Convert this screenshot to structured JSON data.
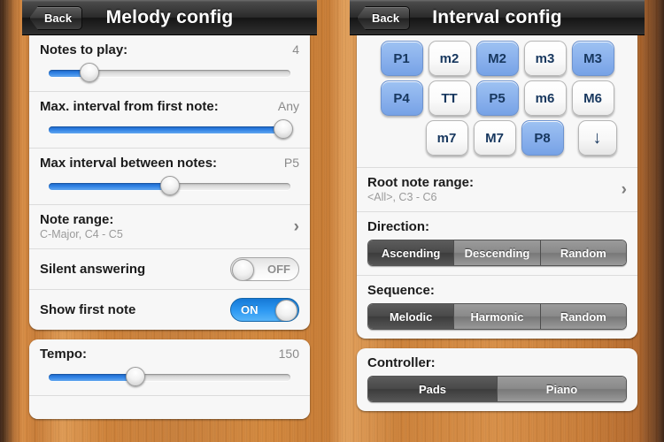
{
  "screens": [
    {
      "nav": {
        "back_label": "Back",
        "title": "Melody config",
        "back_icon": "chevron-left-icon"
      },
      "sliders": [
        {
          "label": "Notes to play:",
          "value": "4",
          "fill_pct": 17
        },
        {
          "label": "Max. interval from first note:",
          "value": "Any",
          "fill_pct": 97
        },
        {
          "label": "Max interval between notes:",
          "value": "P5",
          "fill_pct": 50
        }
      ],
      "note_range": {
        "label": "Note range:",
        "sub": "C-Major, C4 - C5",
        "chevron_icon": "chevron-right-icon"
      },
      "toggles": [
        {
          "label": "Silent answering",
          "state": "OFF",
          "on": false
        },
        {
          "label": "Show first note",
          "state": "ON",
          "on": true
        }
      ],
      "tempo": {
        "label": "Tempo:",
        "value": "150",
        "fill_pct": 36
      }
    },
    {
      "nav": {
        "back_label": "Back",
        "title": "Interval config",
        "back_icon": "chevron-left-icon"
      },
      "intervals": {
        "rows": [
          [
            {
              "label": "P1",
              "selected": true
            },
            {
              "label": "m2",
              "selected": false
            },
            {
              "label": "M2",
              "selected": true
            },
            {
              "label": "m3",
              "selected": false
            },
            {
              "label": "M3",
              "selected": true
            }
          ],
          [
            {
              "label": "P4",
              "selected": true
            },
            {
              "label": "TT",
              "selected": false
            },
            {
              "label": "P5",
              "selected": true
            },
            {
              "label": "m6",
              "selected": false
            },
            {
              "label": "M6",
              "selected": false
            }
          ],
          [
            {
              "label": "m7",
              "selected": false
            },
            {
              "label": "M7",
              "selected": false
            },
            {
              "label": "P8",
              "selected": true
            }
          ]
        ],
        "more_icon": "arrow-down-icon",
        "more_glyph": "↓"
      },
      "root_note_range": {
        "label": "Root note range:",
        "sub": "<All>, C3 - C6",
        "chevron_icon": "chevron-right-icon"
      },
      "direction": {
        "label": "Direction:",
        "options": [
          "Ascending",
          "Descending",
          "Random"
        ],
        "selected_index": 0
      },
      "sequence": {
        "label": "Sequence:",
        "options": [
          "Melodic",
          "Harmonic",
          "Random"
        ],
        "selected_index": 0
      },
      "controller": {
        "label": "Controller:",
        "options": [
          "Pads",
          "Piano"
        ],
        "selected_index": 0
      }
    }
  ],
  "colors": {
    "accent_blue": "#2f81e4",
    "pad_blue": "#89b0ec",
    "pad_text": "#17375e",
    "wood": "#cd8138",
    "navbar": "#2b2b2b"
  }
}
